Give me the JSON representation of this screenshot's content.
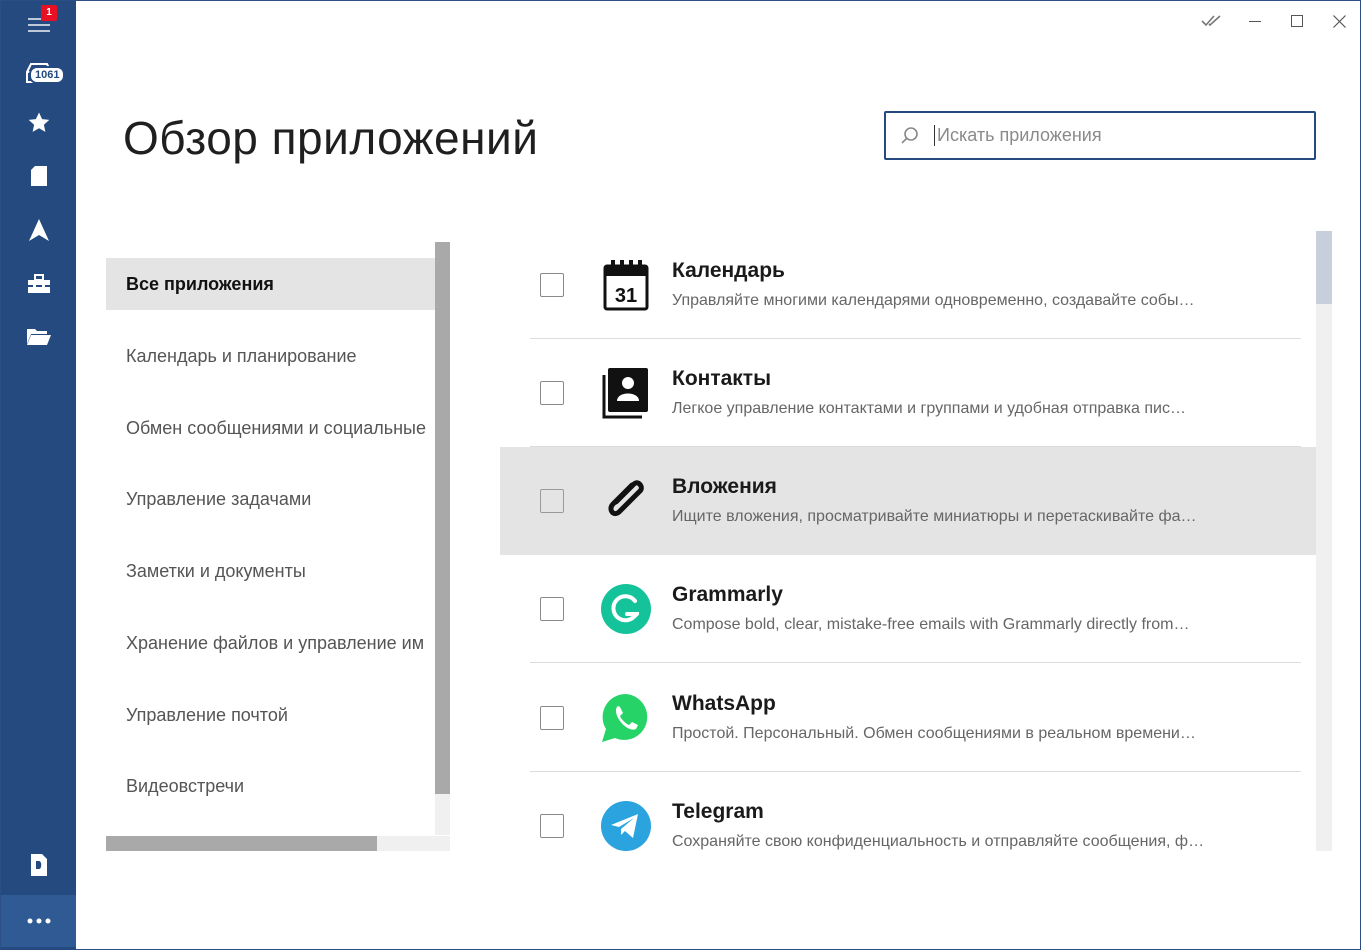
{
  "rail": {
    "notification_badge": "1",
    "inbox_count": "1061"
  },
  "page": {
    "title": "Обзор приложений"
  },
  "search": {
    "placeholder": "Искать приложения",
    "value": ""
  },
  "categories": [
    {
      "label": "Все приложения"
    },
    {
      "label": "Календарь и планирование"
    },
    {
      "label": "Обмен сообщениями и социальные"
    },
    {
      "label": "Управление задачами"
    },
    {
      "label": "Заметки и документы"
    },
    {
      "label": "Хранение файлов и управление им"
    },
    {
      "label": "Управление почтой"
    },
    {
      "label": "Видеовстречи"
    }
  ],
  "apps": [
    {
      "name": "Календарь",
      "desc": "Управляйте многими календарями одновременно, создавайте собы…",
      "icon": "calendar-icon"
    },
    {
      "name": "Контакты",
      "desc": "Легкое управление контактами и группами и удобная отправка пис…",
      "icon": "contacts-icon"
    },
    {
      "name": "Вложения",
      "desc": "Ищите вложения, просматривайте миниатюры и перетаскивайте фа…",
      "icon": "paperclip-icon"
    },
    {
      "name": "Grammarly",
      "desc": "Compose bold, clear, mistake-free emails with Grammarly directly from…",
      "icon": "grammarly-icon"
    },
    {
      "name": "WhatsApp",
      "desc": "Простой. Персональный. Обмен сообщениями в реальном времени…",
      "icon": "whatsapp-icon"
    },
    {
      "name": "Telegram",
      "desc": "Сохраняйте свою конфиденциальность и отправляйте сообщения, ф…",
      "icon": "telegram-icon"
    }
  ],
  "calendar_day": "31",
  "colors": {
    "rail": "#244a80",
    "accent": "#244a80",
    "badge": "#e81123",
    "grammarly": "#15c39a",
    "whatsapp": "#25d366",
    "telegram": "#2aa3df"
  }
}
